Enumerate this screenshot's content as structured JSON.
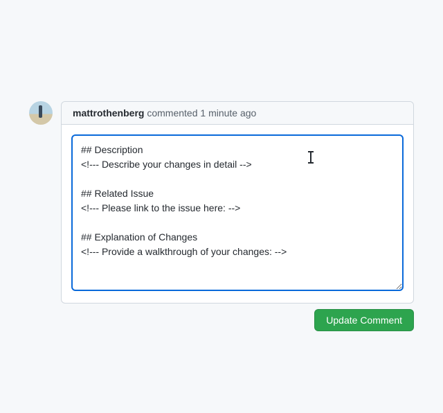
{
  "comment": {
    "author": "mattrothenberg",
    "action": "commented",
    "timestamp": "1 minute ago",
    "body": "## Description\n<!--- Describe your changes in detail -->\n\n## Related Issue\n<!--- Please link to the issue here: -->\n\n## Explanation of Changes\n<!--- Provide a walkthrough of your changes: -->"
  },
  "actions": {
    "update_label": "Update Comment"
  }
}
